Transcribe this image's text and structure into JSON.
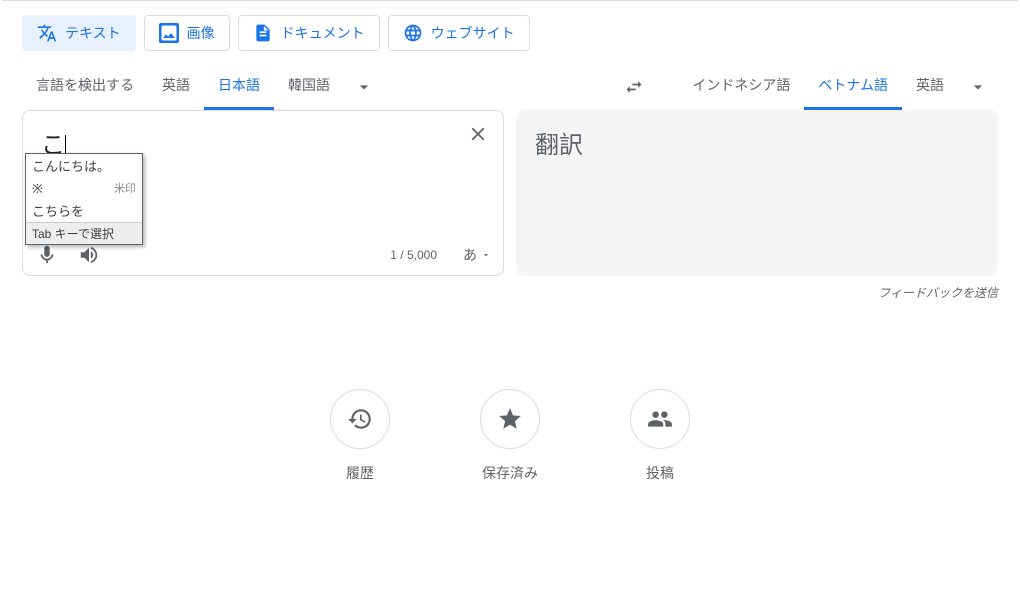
{
  "tabs": {
    "text": "テキスト",
    "image": "画像",
    "document": "ドキュメント",
    "website": "ウェブサイト"
  },
  "source_langs": {
    "detect": "言語を検出する",
    "english": "英語",
    "japanese": "日本語",
    "korean": "韓国語"
  },
  "target_langs": {
    "indonesian": "インドネシア語",
    "vietnamese": "ベトナム語",
    "english": "英語"
  },
  "input": {
    "value": "こ",
    "char_count": "1 / 5,000",
    "ime_char": "あ"
  },
  "output": {
    "placeholder": "翻訳"
  },
  "suggestions": {
    "item1": "こんにちは。",
    "item2": "※",
    "item2_annotation": "米印",
    "item3": "こちらを",
    "footer": "Tab キーで選択"
  },
  "feedback": "フィードバックを送信",
  "actions": {
    "history": "履歴",
    "saved": "保存済み",
    "contribute": "投稿"
  }
}
